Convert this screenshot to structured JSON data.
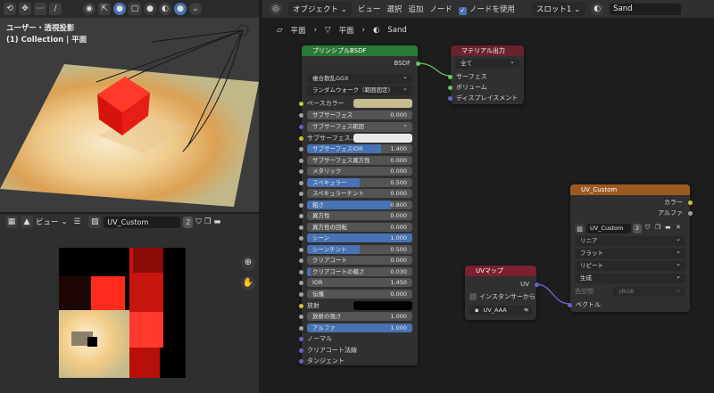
{
  "viewport3d": {
    "title_line1": "ユーザー・透視投影",
    "title_line2": "(1) Collection | 平面"
  },
  "image_editor": {
    "view_label": "ビュー",
    "image_name": "UV_Custom",
    "users": "2"
  },
  "node_editor": {
    "mode": "オブジェクト",
    "menu_view": "ビュー",
    "menu_select": "選択",
    "menu_add": "追加",
    "menu_node": "ノード",
    "use_nodes": "ノードを使用",
    "slot": "スロット1",
    "material": "Sand",
    "breadcrumb": [
      "平面",
      "平面",
      "Sand"
    ]
  },
  "principled": {
    "title": "プリンシプルBSDF",
    "out_bsdf": "BSDF",
    "distribution": "複合散乱GGX",
    "subsurface_method": "ランダムウォーク（範囲固定）",
    "base_color": "ベースカラー",
    "subsurface": {
      "label": "サブサーフェス",
      "value": "0.000"
    },
    "subsurface_radius": "サブサーフェス範囲",
    "subsurface_color": "サブサーフェス...",
    "subsurface_ior": {
      "label": "サブサーフェスIOR",
      "value": "1.400"
    },
    "subsurface_aniso": {
      "label": "サブサーフェス異方性",
      "value": "0.000"
    },
    "metallic": {
      "label": "メタリック",
      "value": "0.000"
    },
    "specular": {
      "label": "スペキュラー",
      "value": "0.500"
    },
    "specular_tint": {
      "label": "スペキュラーチント",
      "value": "0.000"
    },
    "roughness": {
      "label": "粗さ",
      "value": "0.800"
    },
    "anisotropic": {
      "label": "異方性",
      "value": "0.000"
    },
    "anisotropic_rot": {
      "label": "異方性の回転",
      "value": "0.000"
    },
    "sheen": {
      "label": "シーン",
      "value": "1.000"
    },
    "sheen_tint": {
      "label": "シーンチント",
      "value": "0.500"
    },
    "clearcoat": {
      "label": "クリアコート",
      "value": "0.000"
    },
    "clearcoat_rough": {
      "label": "クリアコートの粗さ",
      "value": "0.030"
    },
    "ior": {
      "label": "IOR",
      "value": "1.450"
    },
    "transmission": {
      "label": "伝播",
      "value": "0.000"
    },
    "emission": "放射",
    "emission_strength": {
      "label": "放射の強さ",
      "value": "1.000"
    },
    "alpha": {
      "label": "アルファ",
      "value": "1.000"
    },
    "normal": "ノーマル",
    "clearcoat_normal": "クリアコート法線",
    "tangent": "タンジェント"
  },
  "material_output": {
    "title": "マテリアル出力",
    "target": "全て",
    "surface": "サーフェス",
    "volume": "ボリューム",
    "displacement": "ディスプレイスメント"
  },
  "image_texture": {
    "title": "UV_Custom",
    "out_color": "カラー",
    "out_alpha": "アルファ",
    "image": "UV_Custom",
    "users": "2",
    "interpolation": "リニア",
    "projection": "フラット",
    "extension": "リピート",
    "source": "生成",
    "colorspace_label": "色空間",
    "colorspace": "sRGB",
    "in_vector": "ベクトル"
  },
  "uvmap": {
    "title": "UVマップ",
    "out_uv": "UV",
    "from_instancer": "インスタンサーから",
    "map": "UV_AAA"
  },
  "colors": {
    "base_color_swatch": "#c5bb8c",
    "principled_header": "#2a7a37",
    "output_header": "#6a2230",
    "texture_header": "#9c5a22",
    "uvmap_header": "#7a2030",
    "accent": "#4772b3"
  }
}
